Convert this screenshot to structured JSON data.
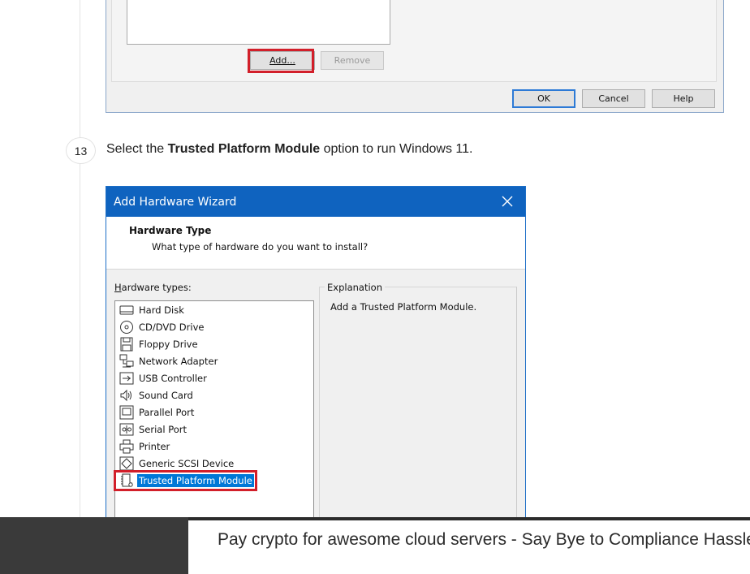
{
  "top_dialog": {
    "add_label": "Add...",
    "remove_label": "Remove",
    "ok_label": "OK",
    "cancel_label": "Cancel",
    "help_label": "Help"
  },
  "step": {
    "number": "13",
    "text_before": "Select the ",
    "text_bold": "Trusted Platform Module",
    "text_after": " option to run Windows 11."
  },
  "wizard": {
    "title": "Add Hardware Wizard",
    "header_title": "Hardware Type",
    "header_subtitle": "What type of hardware do you want to install?",
    "types_label": "Hardware types:",
    "explanation_label": "Explanation",
    "explanation_text": "Add a Trusted Platform Module.",
    "items": [
      {
        "label": "Hard Disk",
        "icon": "hard-disk-icon"
      },
      {
        "label": "CD/DVD Drive",
        "icon": "cd-dvd-icon"
      },
      {
        "label": "Floppy Drive",
        "icon": "floppy-icon"
      },
      {
        "label": "Network Adapter",
        "icon": "network-adapter-icon"
      },
      {
        "label": "USB Controller",
        "icon": "usb-icon"
      },
      {
        "label": "Sound Card",
        "icon": "speaker-icon"
      },
      {
        "label": "Parallel Port",
        "icon": "parallel-port-icon"
      },
      {
        "label": "Serial Port",
        "icon": "serial-port-icon"
      },
      {
        "label": "Printer",
        "icon": "printer-icon"
      },
      {
        "label": "Generic SCSI Device",
        "icon": "scsi-icon"
      },
      {
        "label": "Trusted Platform Module",
        "icon": "tpm-icon",
        "selected": true
      }
    ]
  },
  "ad": {
    "text": "Pay crypto for awesome cloud servers - Say Bye to Compliance Hassles"
  },
  "colors": {
    "titlebar": "#0f63bf",
    "highlight_box": "#d21f2a",
    "selection": "#0078d7"
  }
}
